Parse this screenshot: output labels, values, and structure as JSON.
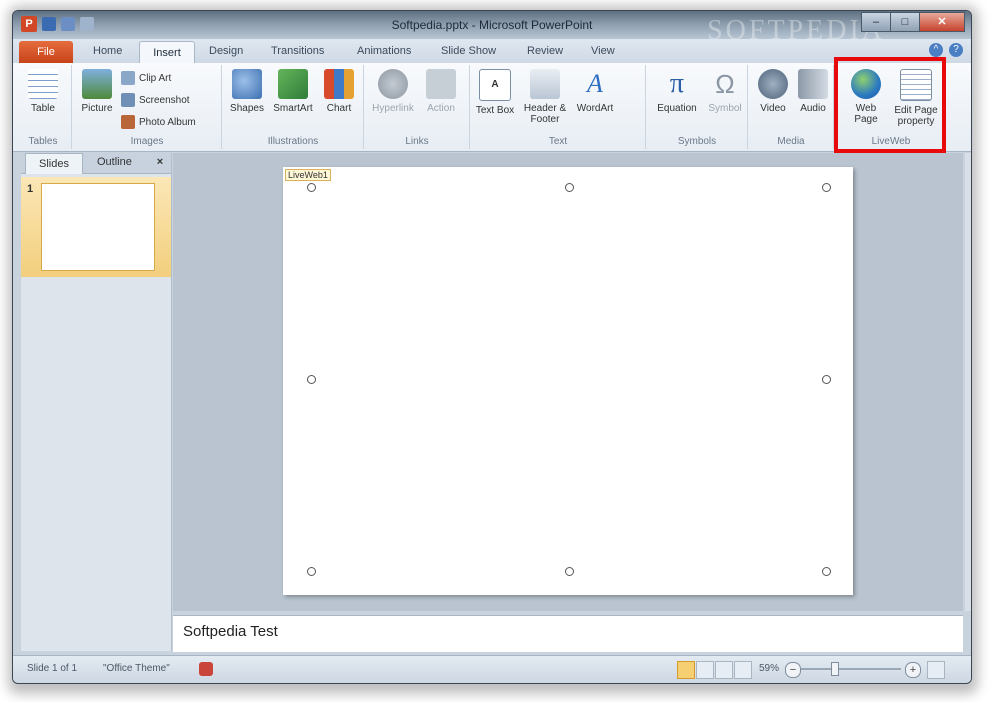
{
  "window": {
    "title": "Softpedia.pptx - Microsoft PowerPoint",
    "watermark": "SOFTPEDIA"
  },
  "tabs": [
    "File",
    "Home",
    "Insert",
    "Design",
    "Transitions",
    "Animations",
    "Slide Show",
    "Review",
    "View"
  ],
  "active_tab": "Insert",
  "ribbon": {
    "tables": {
      "label": "Tables",
      "table": "Table"
    },
    "images": {
      "label": "Images",
      "picture": "Picture",
      "clip_art": "Clip Art",
      "screenshot": "Screenshot",
      "photo_album": "Photo Album"
    },
    "illustrations": {
      "label": "Illustrations",
      "shapes": "Shapes",
      "smartart": "SmartArt",
      "chart": "Chart"
    },
    "links": {
      "label": "Links",
      "hyperlink": "Hyperlink",
      "action": "Action"
    },
    "text": {
      "label": "Text",
      "text_box": "Text Box",
      "header_footer": "Header & Footer",
      "wordart": "WordArt"
    },
    "symbols": {
      "label": "Symbols",
      "equation": "Equation",
      "symbol": "Symbol"
    },
    "media": {
      "label": "Media",
      "video": "Video",
      "audio": "Audio"
    },
    "liveweb": {
      "label": "LiveWeb",
      "web_page": "Web Page",
      "edit_page_property": "Edit Page property"
    }
  },
  "left_panel": {
    "tab_slides": "Slides",
    "tab_outline": "Outline",
    "close": "×",
    "slide_number": "1"
  },
  "slide": {
    "object_label": "LiveWeb1"
  },
  "notes": {
    "text": "Softpedia Test"
  },
  "status": {
    "slide_info": "Slide 1 of 1",
    "theme": "\"Office Theme\"",
    "zoom": "59%"
  },
  "icons": {
    "table": "table-icon",
    "picture": "picture-icon",
    "shapes": "shapes-icon",
    "smartart": "smartart-icon",
    "chart": "chart-icon",
    "equation": "pi-icon",
    "symbol": "omega-icon",
    "web_page": "globe-icon",
    "edit_page": "edit-page-icon"
  }
}
